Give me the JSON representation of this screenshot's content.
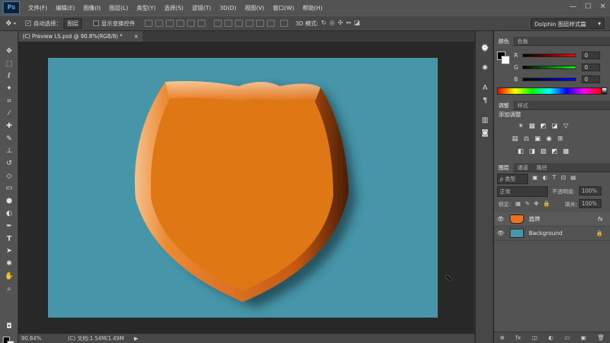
{
  "app": {
    "logo": "Ps"
  },
  "menu": [
    "文件(F)",
    "编辑(E)",
    "图像(I)",
    "图层(L)",
    "类型(Y)",
    "选择(S)",
    "滤镜(T)",
    "3D(D)",
    "视图(V)",
    "窗口(W)",
    "帮助(H)"
  ],
  "window_controls": {
    "minimize": "—",
    "restore": "☐",
    "close": "✕"
  },
  "options": {
    "auto_select_label": "自动选择：",
    "auto_select_value": "图层",
    "show_transform_label": "显示变换控件",
    "mode_3d_label": "3D 模式:",
    "workspace": "Dolphin 图层样式篇"
  },
  "document_tab": {
    "title": "(C) Preview LS.psd @ 90.8%(RGB/8) *",
    "close": "×"
  },
  "status": {
    "zoom": "90.84%",
    "doc": "(C) 文档:1.54M/1.49M",
    "arrow": "▶"
  },
  "color_panel": {
    "tabs": [
      "颜色",
      "色板"
    ],
    "sliders": [
      {
        "label": "R",
        "value": "0"
      },
      {
        "label": "G",
        "value": "0"
      },
      {
        "label": "B",
        "value": "0"
      }
    ]
  },
  "adjust_panel": {
    "tabs": [
      "调整",
      "样式"
    ],
    "heading": "添加调整",
    "icons_row1": [
      "☀",
      "▦",
      "◩",
      "◪",
      "▽"
    ],
    "icons_row2": [
      "▤",
      "⚖",
      "▣",
      "◉",
      "⊞"
    ],
    "icons_row3": [
      "◧",
      "◨",
      "▨",
      "◩",
      "▩"
    ]
  },
  "layers_panel": {
    "tabs": [
      "图层",
      "通道",
      "路径"
    ],
    "filter_label": "ρ 类型",
    "blend_mode": "正常",
    "opacity_label": "不透明度:",
    "opacity_value": "100%",
    "lock_label": "锁定:",
    "fill_label": "填充:",
    "fill_value": "100%",
    "layers": [
      {
        "name": "盾牌",
        "fx": "fx",
        "thumb_color": "#e8731c"
      },
      {
        "name": "Background",
        "fx": "",
        "thumb_color": "#4695a9"
      }
    ],
    "footer_icons": [
      "⊕",
      "fx",
      "◫",
      "◐",
      "▭",
      "▣",
      "🗑"
    ]
  },
  "colors": {
    "canvas_bg": "#4695a9",
    "shield_orange": "#e8761c",
    "shield_dark": "#6d2c06"
  }
}
